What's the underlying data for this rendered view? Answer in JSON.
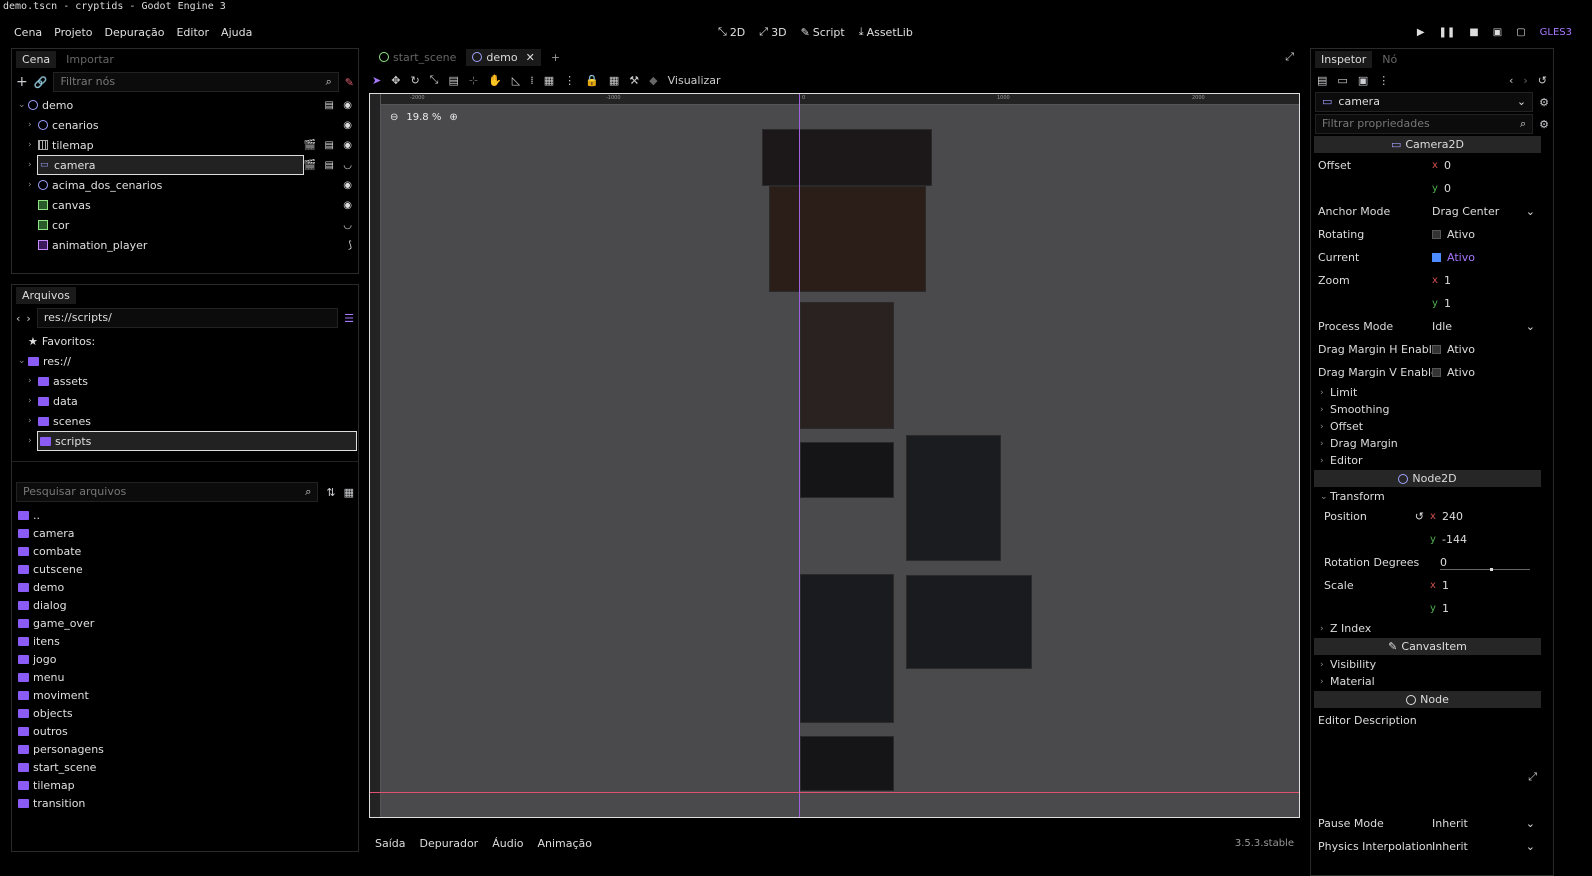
{
  "window": {
    "title": "demo.tscn - cryptids - Godot Engine 3"
  },
  "menu": {
    "items": [
      "Cena",
      "Projeto",
      "Depuração",
      "Editor",
      "Ajuda"
    ]
  },
  "main_buttons": {
    "b2d": "2D",
    "b3d": "3D",
    "script": "Script",
    "assetlib": "AssetLib"
  },
  "renderer": "GLES3",
  "scene_dock": {
    "tabs": [
      "Cena",
      "Importar"
    ],
    "filter_placeholder": "Filtrar nós",
    "nodes": [
      "demo",
      "cenarios",
      "tilemap",
      "camera",
      "acima_dos_cenarios",
      "canvas",
      "cor",
      "animation_player"
    ]
  },
  "files_dock": {
    "title": "Arquivos",
    "path": "res://scripts/",
    "favorites": "Favoritos:",
    "root": "res://",
    "tree": [
      "assets",
      "data",
      "scenes",
      "scripts"
    ],
    "search_placeholder": "Pesquisar arquivos",
    "list": [
      "..",
      "camera",
      "combate",
      "cutscene",
      "demo",
      "dialog",
      "game_over",
      "itens",
      "jogo",
      "menu",
      "moviment",
      "objects",
      "outros",
      "personagens",
      "start_scene",
      "tilemap",
      "transition"
    ]
  },
  "editor": {
    "scene_tabs": [
      "start_scene",
      "demo"
    ],
    "view_button": "Visualizar",
    "zoom": "19.8 %",
    "ruler_h": [
      "-2000",
      "-1000",
      "0",
      "1000",
      "2000"
    ],
    "ruler_v": [
      "-3000",
      "-2000",
      "-1000",
      "0"
    ]
  },
  "bottom": {
    "tabs": [
      "Saída",
      "Depurador",
      "Áudio",
      "Animação"
    ],
    "version": "3.5.3.stable"
  },
  "inspector": {
    "tabs": [
      "Inspetor",
      "Nó"
    ],
    "node_name": "camera",
    "filter_placeholder": "Filtrar propriedades",
    "class_camera": "Camera2D",
    "offset": {
      "label": "Offset",
      "x": "0",
      "y": "0"
    },
    "anchor_mode": {
      "label": "Anchor Mode",
      "value": "Drag Center"
    },
    "rotating": {
      "label": "Rotating",
      "value": "Ativo"
    },
    "current": {
      "label": "Current",
      "value": "Ativo"
    },
    "zoom": {
      "label": "Zoom",
      "x": "1",
      "y": "1"
    },
    "process_mode": {
      "label": "Process Mode",
      "value": "Idle"
    },
    "drag_h": {
      "label": "Drag Margin H Enabled",
      "value": "Ativo"
    },
    "drag_v": {
      "label": "Drag Margin V Enabled",
      "value": "Ativo"
    },
    "groups_camera": [
      "Limit",
      "Smoothing",
      "Offset",
      "Drag Margin",
      "Editor"
    ],
    "class_node2d": "Node2D",
    "transform_group": "Transform",
    "position": {
      "label": "Position",
      "x": "240",
      "y": "-144"
    },
    "rotation": {
      "label": "Rotation Degrees",
      "value": "0"
    },
    "scale": {
      "label": "Scale",
      "x": "1",
      "y": "1"
    },
    "z_index": "Z Index",
    "class_canvasitem": "CanvasItem",
    "groups_canvas": [
      "Visibility",
      "Material"
    ],
    "class_node": "Node",
    "editor_description": "Editor Description",
    "pause_mode": {
      "label": "Pause Mode",
      "value": "Inherit"
    },
    "physics_interp": {
      "label": "Physics Interpolation M",
      "value": "Inherit"
    }
  }
}
